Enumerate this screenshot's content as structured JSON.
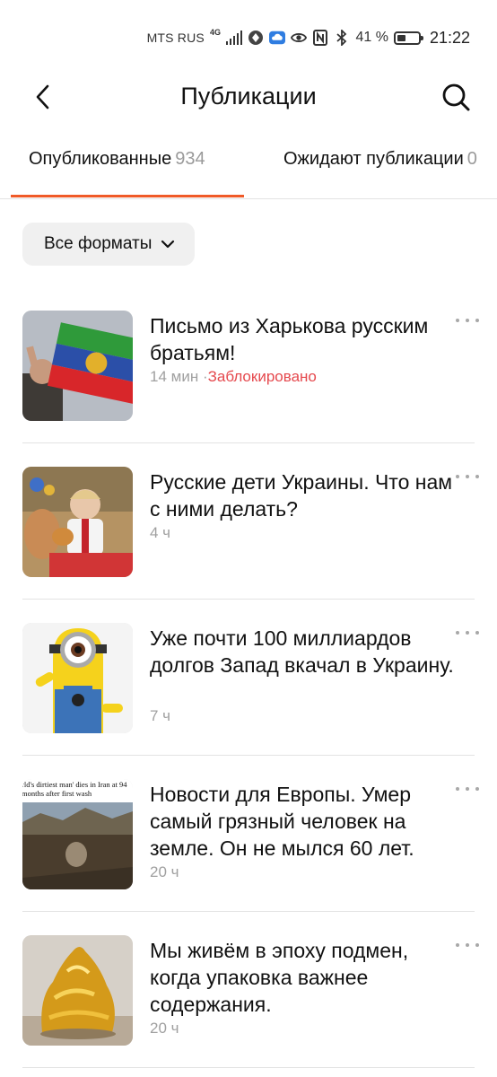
{
  "status_bar": {
    "carrier": "MTS RUS",
    "network": "4G",
    "battery_percent": "41 %",
    "battery_level": 0.41,
    "time": "21:22"
  },
  "header": {
    "title": "Публикации",
    "back_icon": "chevron-left-icon",
    "search_icon": "search-icon"
  },
  "tabs": [
    {
      "label": "Опубликованные",
      "count": "934",
      "active": true
    },
    {
      "label": "Ожидают публикации",
      "count": "0",
      "active": false
    }
  ],
  "accent_color": "#f05a28",
  "filter": {
    "label": "Все форматы",
    "icon": "chevron-down-icon"
  },
  "publications": [
    {
      "title": "Письмо из Харькова русским братьям!",
      "time": "14 мин",
      "separator": "·",
      "status": "Заблокировано",
      "thumb_icon": "flag-photo"
    },
    {
      "title": "Русские дети Украины. Что нам с ними делать?",
      "time": "4 ч",
      "thumb_icon": "child-photo"
    },
    {
      "title": "Уже почти 100 миллиардов долгов Запад вкачал в Украину.",
      "time": "7 ч",
      "thumb_icon": "minion-photo"
    },
    {
      "title": "Новости для Европы. Умер самый грязный человек на земле. Он не мылся 60 лет.",
      "time": "20 ч",
      "thumb_icon": "newspaper-photo",
      "thumb_caption_1": "rld's dirtiest man' dies in Iran at 94",
      "thumb_caption_2": "months after first wash"
    },
    {
      "title": "Мы живём в эпоху подмен, когда упаковка важнее содержания.",
      "time": "20 ч",
      "thumb_icon": "gold-package-photo"
    }
  ]
}
